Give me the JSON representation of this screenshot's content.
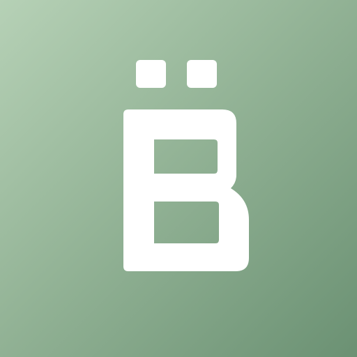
{
  "app_icon": {
    "name": "app-icon",
    "background_colors": [
      "#b6d1b6",
      "#94b497",
      "#6b9173"
    ],
    "logo": {
      "letter": "B",
      "diacritic": "diaeresis",
      "glyph_icon": "b-umlaut-logo-icon",
      "color": "#ffffff"
    }
  }
}
